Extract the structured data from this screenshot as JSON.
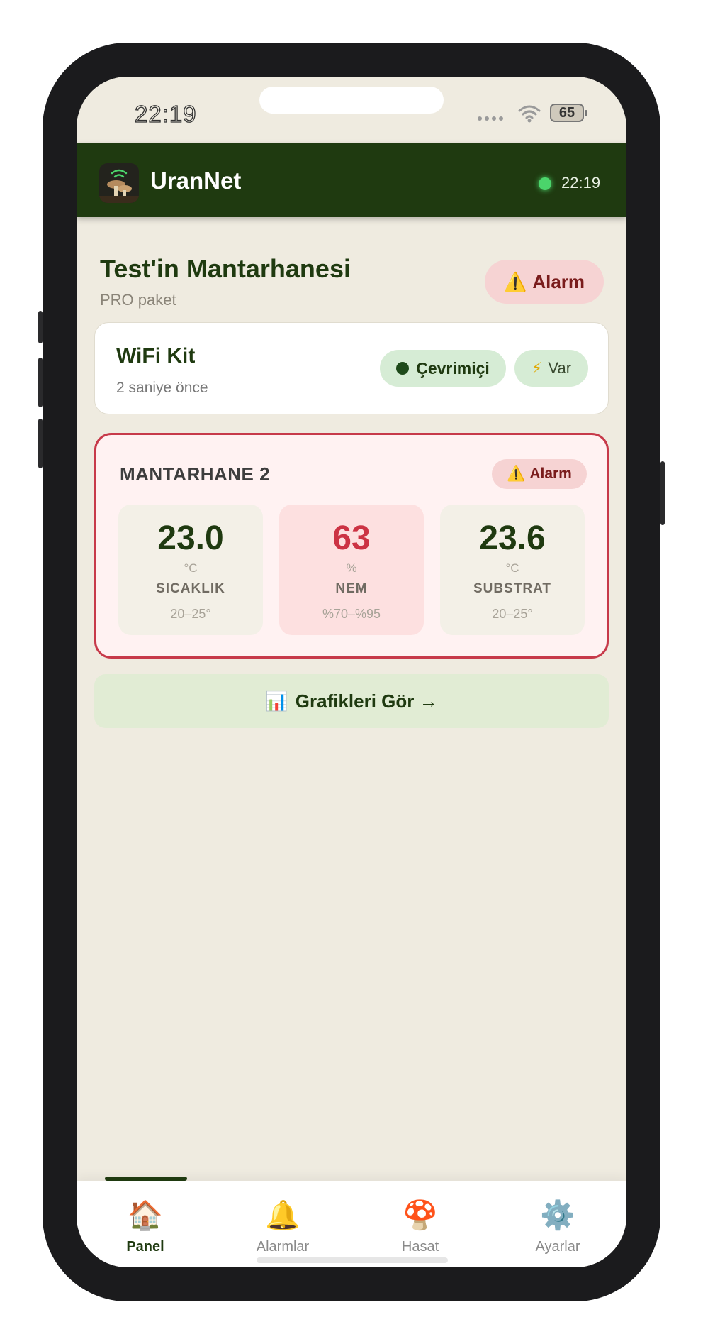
{
  "status_bar": {
    "time": "22:19",
    "battery": "65"
  },
  "header": {
    "app_title": "UranNet",
    "time": "22:19",
    "live_color": "#4bd46b"
  },
  "farm": {
    "name": "Test'in Mantarhanesi",
    "plan": "PRO paket",
    "alarm_icon": "⚠️",
    "alarm_label": "Alarm"
  },
  "device": {
    "name": "WiFi Kit",
    "last_seen": "2 saniye önce",
    "online_label": "Çevrimiçi",
    "power_icon": "⚡",
    "power_label": "Var"
  },
  "room": {
    "title": "MANTARHANE 2",
    "alarm_icon": "⚠️",
    "alarm_label": "Alarm",
    "metrics": [
      {
        "value": "23.0",
        "unit": "°C",
        "label": "SICAKLIK",
        "range": "20–25°",
        "status": "normal"
      },
      {
        "value": "63",
        "unit": "%",
        "label": "NEM",
        "range": "%70–%95",
        "status": "alarm"
      },
      {
        "value": "23.6",
        "unit": "°C",
        "label": "SUBSTRAT",
        "range": "20–25°",
        "status": "normal"
      }
    ]
  },
  "graph_button": {
    "icon": "📊",
    "label": "Grafikleri Gör →"
  },
  "tabs": [
    {
      "icon": "🏠",
      "label": "Panel",
      "active": true
    },
    {
      "icon": "🔔",
      "label": "Alarmlar",
      "active": false
    },
    {
      "icon": "🍄",
      "label": "Hasat",
      "active": false
    },
    {
      "icon": "⚙️",
      "label": "Ayarlar",
      "active": false
    }
  ],
  "colors": {
    "brand": "#1f3a10",
    "background": "#efebe0",
    "alarm": "#c73a4a",
    "online_bg": "#d6ecd5"
  }
}
